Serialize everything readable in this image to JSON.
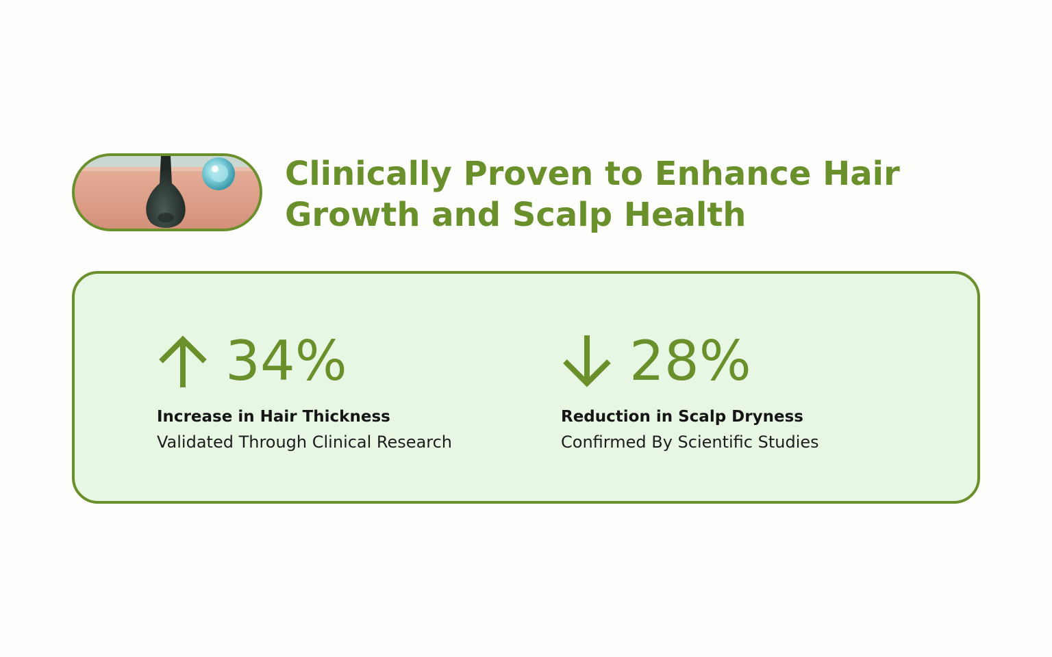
{
  "header": {
    "title": "Clinically Proven to Enhance Hair Growth and Scalp Health",
    "illustration": "hair-follicle-illustration"
  },
  "stats": [
    {
      "direction": "up",
      "icon": "arrow-up-icon",
      "value": "34%",
      "label": "Increase in Hair Thickness",
      "sublabel": "Validated Through Clinical Research"
    },
    {
      "direction": "down",
      "icon": "arrow-down-icon",
      "value": "28%",
      "label": "Reduction in Scalp Dryness",
      "sublabel": "Confirmed By Scientific Studies"
    }
  ],
  "colors": {
    "accent": "#6a902c",
    "card_background": "#e7f7e3",
    "page_background": "#fdfdfc",
    "text_dark": "#151515"
  }
}
